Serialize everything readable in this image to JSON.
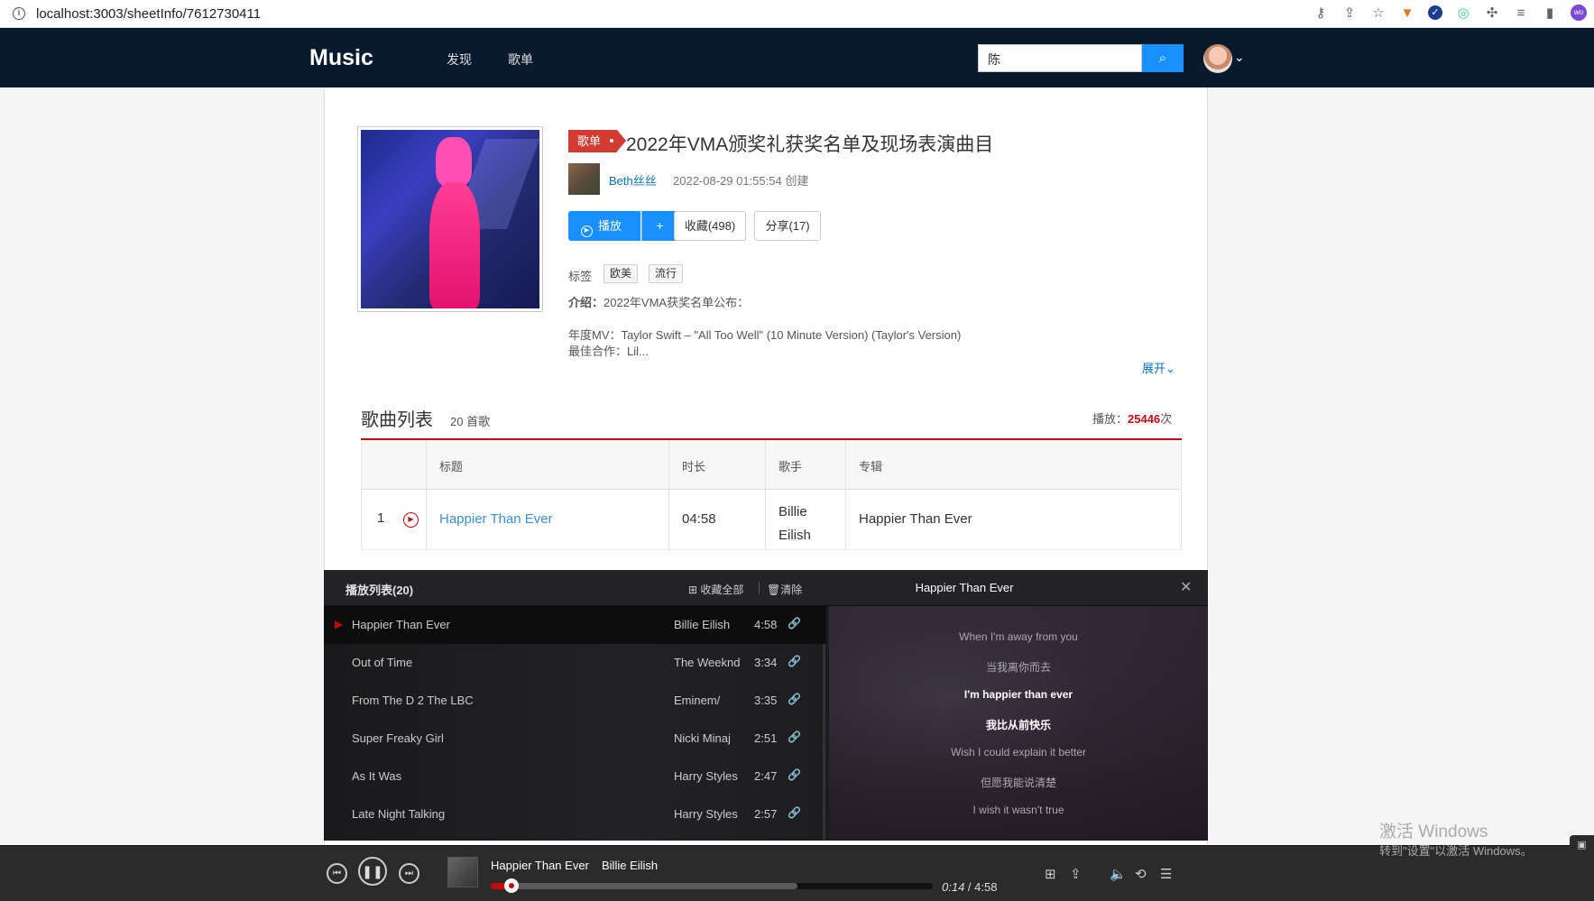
{
  "browser": {
    "url_host": "localhost",
    "url_rest": ":3003/sheetInfo/7612730411"
  },
  "header": {
    "logo": "Music",
    "nav": [
      "发现",
      "歌单"
    ],
    "search_value": "陈"
  },
  "sheet": {
    "tag": "歌单",
    "title": "2022年VMA颁奖礼获奖名单及现场表演曲目",
    "creator": "Beth丝丝",
    "created": "2022-08-29 01:55:54 创建",
    "play_label": "播放",
    "add_label": "+",
    "collect_label": "收藏(498)",
    "share_label": "分享(17)",
    "tags_label": "标签",
    "tags": [
      "欧美",
      "流行"
    ],
    "intro_label": "介绍：",
    "intro_line1": "2022年VMA获奖名单公布：",
    "intro_line2": "年度MV：Taylor Swift – \"All Too Well\" (10 Minute Version) (Taylor's Version)",
    "intro_line3": "最佳合作：Lil...",
    "expand_label": "展开"
  },
  "song_list": {
    "title": "歌曲列表",
    "count": "20 首歌",
    "plays_label": "播放：",
    "plays_value": "25446",
    "plays_unit": "次",
    "columns": [
      "标题",
      "时长",
      "歌手",
      "专辑"
    ],
    "rows": [
      {
        "no": "1",
        "title": "Happier Than Ever",
        "duration": "04:58",
        "artist": "Billie Eilish",
        "album": "Happier Than Ever"
      }
    ]
  },
  "playlist": {
    "title": "播放列表(20)",
    "collect_all": "收藏全部",
    "clear": "清除",
    "current_song": "Happier Than Ever",
    "items": [
      {
        "name": "Happier Than Ever",
        "artist": "Billie Eilish",
        "time": "4:58",
        "active": true
      },
      {
        "name": "Out of Time",
        "artist": "The Weeknd",
        "time": "3:34"
      },
      {
        "name": "From The D 2 The LBC",
        "artist": "Eminem/",
        "time": "3:35"
      },
      {
        "name": "Super Freaky Girl",
        "artist": "Nicki Minaj",
        "time": "2:51"
      },
      {
        "name": "As It Was",
        "artist": "Harry Styles",
        "time": "2:47"
      },
      {
        "name": "Late Night Talking",
        "artist": "Harry Styles",
        "time": "2:57"
      }
    ],
    "lyrics": [
      {
        "text": "When I'm away from you",
        "on": false
      },
      {
        "text": "当我离你而去",
        "on": false
      },
      {
        "text": "I'm happier than ever",
        "on": true
      },
      {
        "text": "我比从前快乐",
        "on": true
      },
      {
        "text": "Wish I could explain it better",
        "on": false
      },
      {
        "text": "但愿我能说清楚",
        "on": false
      },
      {
        "text": "I wish it wasn't true",
        "on": false
      }
    ]
  },
  "player": {
    "title": "Happier Than Ever",
    "artist": "Billie Eilish",
    "current": "0:14",
    "total": "4:58",
    "progress_fraction": 0.047
  },
  "os": {
    "watermark_line1": "激活 Windows",
    "watermark_line2": "转到\"设置\"以激活 Windows。"
  },
  "colors": {
    "header_bg": "#0a1a2e",
    "accent_blue": "#1890ff",
    "brand_red": "#c20c0c"
  }
}
